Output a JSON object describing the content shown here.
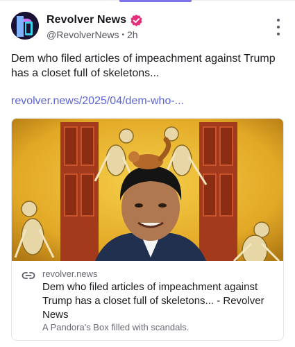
{
  "post": {
    "author_name": "Revolver News",
    "handle": "@RevolverNews",
    "separator": "•",
    "timestamp": "2h",
    "text": "Dem who filed articles of impeachment against Trump has a closet full of skeletons...",
    "link_text": "revolver.news/2025/04/dem-who-...",
    "verified": true
  },
  "card": {
    "domain": "revolver.news",
    "title": "Dem who filed articles of impeachment against Trump has a closet full of skeletons... - Revolver News",
    "description": "A Pandora's Box filled with scandals."
  },
  "colors": {
    "accent": "#7b73e6",
    "link": "#5a63d6",
    "verified_badge": "#e4307a",
    "image_background": "#e7b32a",
    "door": "#a33a1c"
  },
  "icons": {
    "avatar": "revolver-r-logo",
    "verified": "verified-check-icon",
    "more": "vertical-ellipsis-icon",
    "link": "link-chain-icon"
  }
}
